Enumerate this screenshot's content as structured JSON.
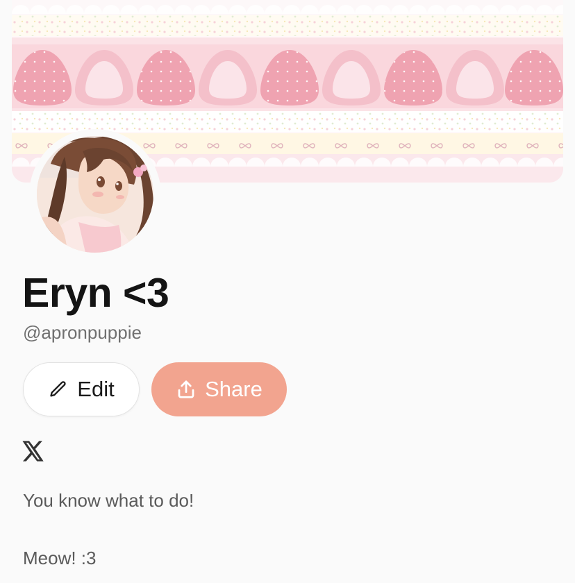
{
  "profile": {
    "display_name": "Eryn <3",
    "handle": "@apronpuppie",
    "banner_icon": "strawberry-lace-banner",
    "avatar_icon": "anime-girl-avatar"
  },
  "actions": {
    "edit_label": "Edit",
    "edit_icon": "pencil-icon",
    "share_label": "Share",
    "share_icon": "upload-share-icon"
  },
  "socials": [
    {
      "icon": "x-logo-icon"
    }
  ],
  "bio": {
    "line1": "You know what to do!",
    "line2": "Meow! :3"
  },
  "colors": {
    "background": "#fafafa",
    "share_button": "#f2a48f",
    "edit_button": "#ffffff",
    "banner_strawberry": "#ec8fa0",
    "banner_cream": "#fff6de",
    "banner_pink": "#fbdde2"
  }
}
